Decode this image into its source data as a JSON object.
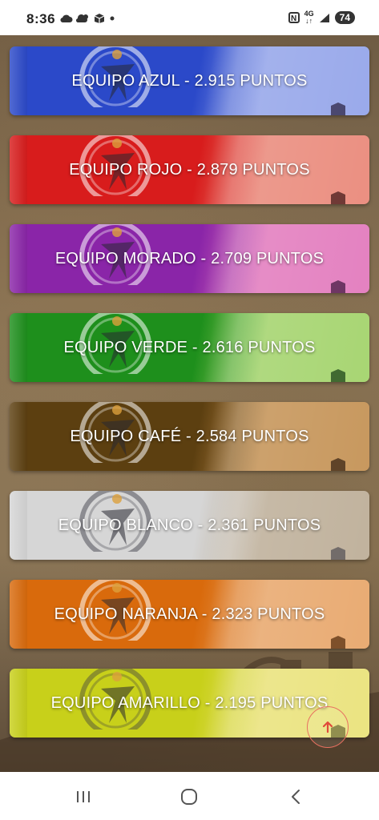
{
  "status_bar": {
    "time": "8:36",
    "left_icons": [
      "cloud-icon",
      "cloud-sun-icon",
      "box-icon",
      "dot-icon"
    ],
    "nfc_label": "N",
    "network_label": "4G",
    "battery": "74"
  },
  "teams": [
    {
      "label": "EQUIPO AZUL - 2.915 PUNTOS",
      "color_from": "#2b49c9",
      "color_to": "#8c9ee8"
    },
    {
      "label": "EQUIPO ROJO - 2.879 PUNTOS",
      "color_from": "#d81c1c",
      "color_to": "#e88070"
    },
    {
      "label": "EQUIPO MORADO - 2.709 PUNTOS",
      "color_from": "#8a25a8",
      "color_to": "#e070b8"
    },
    {
      "label": "EQUIPO VERDE - 2.616 PUNTOS",
      "color_from": "#1e8f1c",
      "color_to": "#9cd060"
    },
    {
      "label": "EQUIPO CAFÉ - 2.584 PUNTOS",
      "color_from": "#5c3f10",
      "color_to": "#c08a48"
    },
    {
      "label": "EQUIPO BLANCO - 2.361 PUNTOS",
      "color_from": "#d6d6d6",
      "color_to": "#b8a890"
    },
    {
      "label": "EQUIPO NARANJA - 2.323 PUNTOS",
      "color_from": "#d96a0c",
      "color_to": "#e6a060"
    },
    {
      "label": "EQUIPO AMARILLO - 2.195 PUNTOS",
      "color_from": "#c8d01a",
      "color_to": "#e8e070"
    }
  ],
  "scroll_top": {
    "icon": "arrow-up-icon",
    "color": "#e87060"
  },
  "nav": {
    "icons": [
      "recent-apps-icon",
      "home-icon",
      "back-icon"
    ]
  }
}
